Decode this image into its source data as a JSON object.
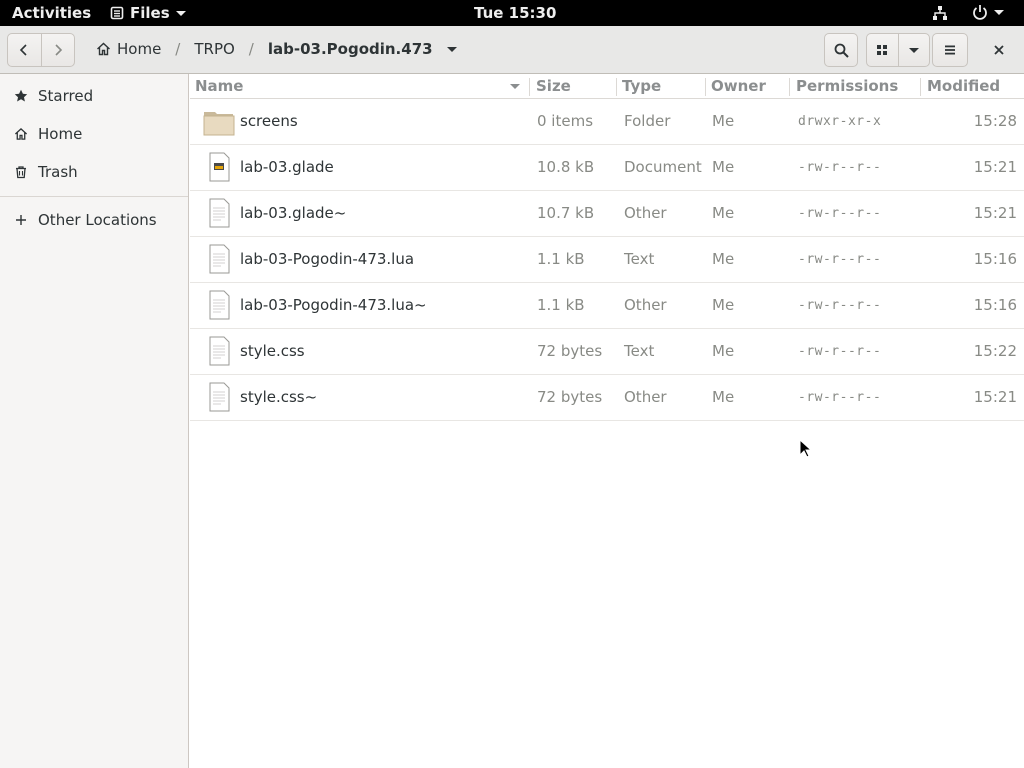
{
  "topbar": {
    "activities": "Activities",
    "app_menu": "Files",
    "clock": "Tue 15:30"
  },
  "header": {
    "breadcrumbs": [
      "Home",
      "TRPO",
      "lab-03.Pogodin.473"
    ]
  },
  "sidebar": {
    "items": [
      {
        "label": "Starred",
        "icon": "star-icon"
      },
      {
        "label": "Home",
        "icon": "home-icon"
      },
      {
        "label": "Trash",
        "icon": "trash-icon"
      }
    ],
    "other": {
      "label": "Other Locations",
      "icon": "plus-icon"
    }
  },
  "columns": {
    "name": "Name",
    "size": "Size",
    "type": "Type",
    "owner": "Owner",
    "permissions": "Permissions",
    "modified": "Modified"
  },
  "files": [
    {
      "name": "screens",
      "size": "0 items",
      "type": "Folder",
      "owner": "Me",
      "permissions": "drwxr-xr-x",
      "modified": "15:28",
      "icon": "folder-icon"
    },
    {
      "name": "lab-03.glade",
      "size": "10.8 kB",
      "type": "Document",
      "owner": "Me",
      "permissions": "-rw-r--r--",
      "modified": "15:21",
      "icon": "glade-document-icon"
    },
    {
      "name": "lab-03.glade~",
      "size": "10.7 kB",
      "type": "Other",
      "owner": "Me",
      "permissions": "-rw-r--r--",
      "modified": "15:21",
      "icon": "file-icon"
    },
    {
      "name": "lab-03-Pogodin-473.lua",
      "size": "1.1 kB",
      "type": "Text",
      "owner": "Me",
      "permissions": "-rw-r--r--",
      "modified": "15:16",
      "icon": "file-icon"
    },
    {
      "name": "lab-03-Pogodin-473.lua~",
      "size": "1.1 kB",
      "type": "Other",
      "owner": "Me",
      "permissions": "-rw-r--r--",
      "modified": "15:16",
      "icon": "file-icon"
    },
    {
      "name": "style.css",
      "size": "72 bytes",
      "type": "Text",
      "owner": "Me",
      "permissions": "-rw-r--r--",
      "modified": "15:22",
      "icon": "file-icon"
    },
    {
      "name": "style.css~",
      "size": "72 bytes",
      "type": "Other",
      "owner": "Me",
      "permissions": "-rw-r--r--",
      "modified": "15:21",
      "icon": "file-icon"
    }
  ]
}
